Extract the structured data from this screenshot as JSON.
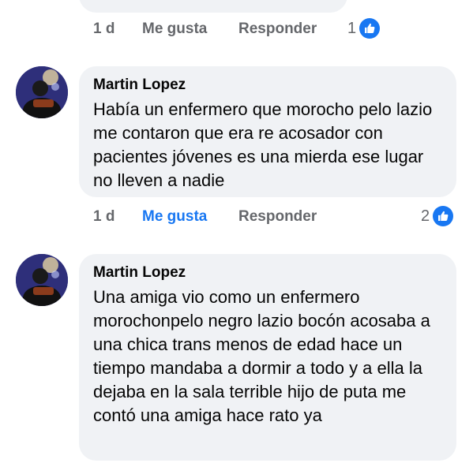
{
  "top_comment": {
    "time": "1 d",
    "like_label": "Me gusta",
    "reply_label": "Responder",
    "likes": "1"
  },
  "comments": [
    {
      "author": "Martin Lopez",
      "text": "Había un enfermero que morocho pelo lazio me contaron que era re acosador con pacientes jóvenes es una mierda ese lugar no lleven a nadie",
      "time": "1 d",
      "like_label": "Me gusta",
      "reply_label": "Responder",
      "likes": "2",
      "liked": true
    },
    {
      "author": "Martin Lopez",
      "text": "Una amiga vio como un enfermero morochonpelo negro lazio bocón acosaba a una chica trans menos de edad hace un tiempo mandaba a dormir a todo y a ella la dejaba en la sala terrible hijo de puta me contó una amiga hace rato ya"
    }
  ],
  "colors": {
    "bubble": "#f0f2f5",
    "accent": "#1877f2",
    "meta": "#65676b"
  },
  "icons": {
    "like": "thumbs-up-icon",
    "avatar": "profile-photo"
  }
}
